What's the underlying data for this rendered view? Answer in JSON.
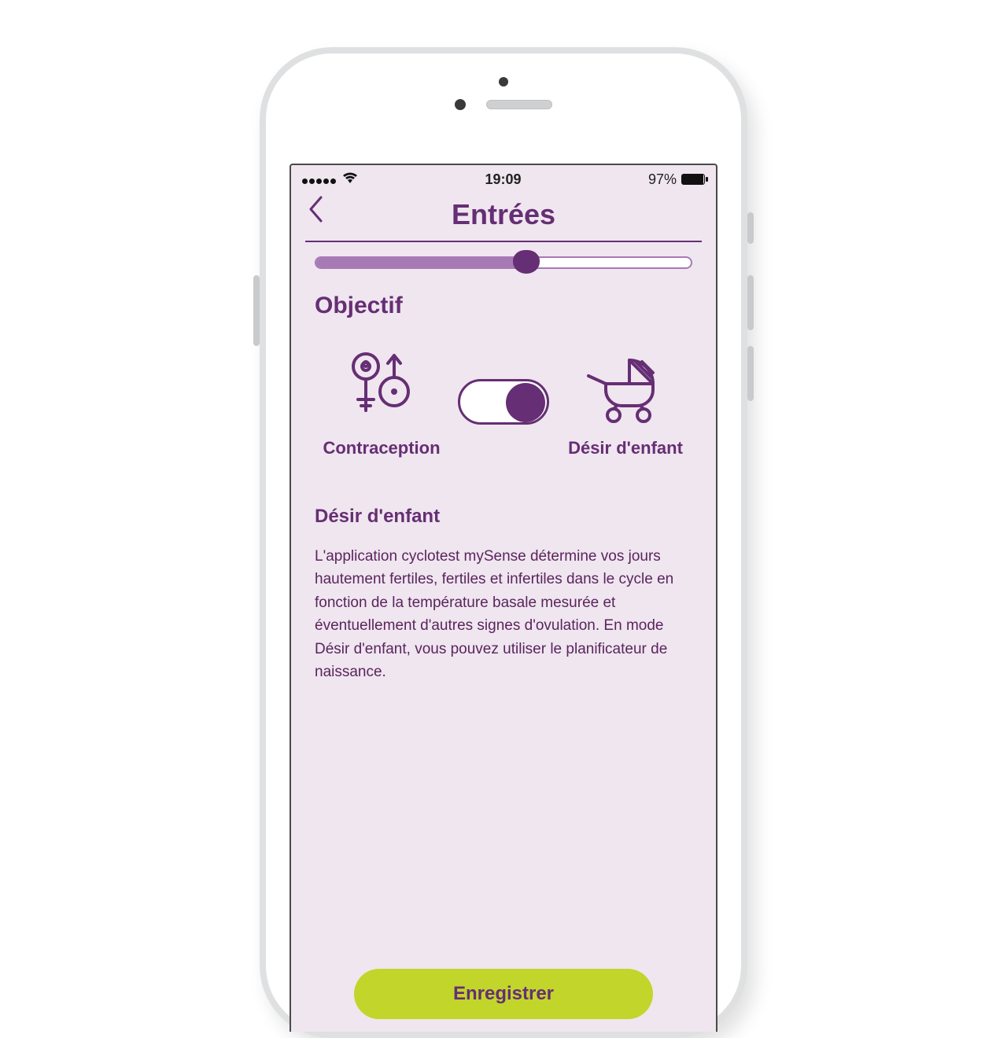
{
  "status": {
    "time": "19:09",
    "battery_pct": "97%"
  },
  "header": {
    "title": "Entrées"
  },
  "slider": {
    "percent": 56
  },
  "objective": {
    "heading": "Objectif",
    "left_label": "Contraception",
    "right_label": "Désir d'enfant",
    "selected": "right"
  },
  "description": {
    "title": "Désir d'enfant",
    "body": "L'application cyclotest mySense détermine vos jours hautement fertiles, fertiles et infertiles dans le cycle en fonction de la température basale mesurée et éventuellement d'autres signes d'ovulation. En mode Désir d'enfant, vous pouvez utiliser le planificateur de naissance."
  },
  "actions": {
    "save": "Enregistrer"
  },
  "icons": {
    "back": "chevron-left",
    "contraception": "gender-symbols",
    "desire": "stroller"
  }
}
